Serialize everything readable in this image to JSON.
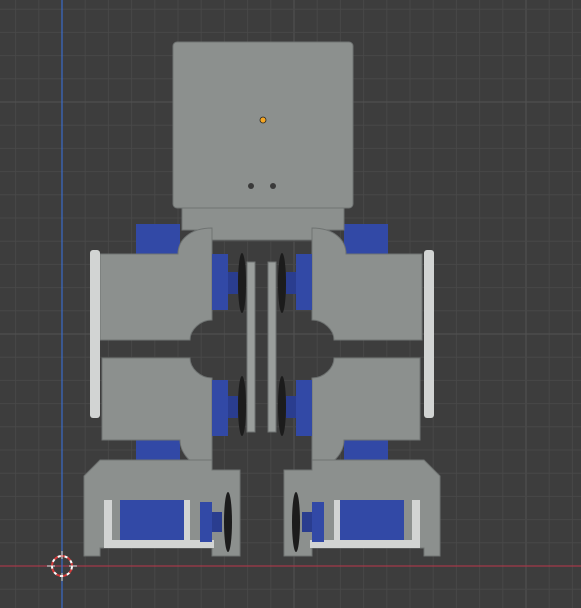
{
  "viewport": {
    "background": "#3d3d3d",
    "grid_minor_color": "#484848",
    "grid_major_color": "#525252",
    "axis_x_color": "#a33a48",
    "axis_y_color": "#3a6bc9"
  },
  "model": {
    "plate_color": "#8c908e",
    "plate_edge_color": "#6f7372",
    "servo_color": "#3249a6",
    "servo_dark_color": "#1f2f74",
    "rim_light_color": "#d2d4d3",
    "rim_dark_color": "#1c1c1c"
  },
  "cursor": {
    "icon": "3d-cursor-icon"
  },
  "origin": {
    "color": "#f5a623"
  }
}
